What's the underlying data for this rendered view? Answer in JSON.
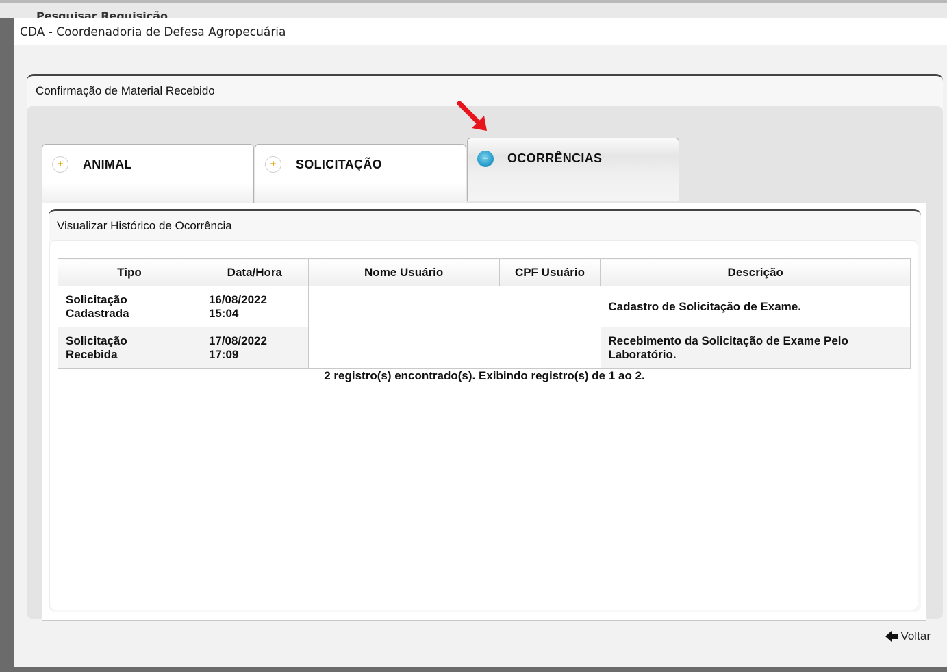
{
  "background_page": {
    "title": "Pesquisar Requisição"
  },
  "dialog": {
    "title": "CDA - Coordenadoria de Defesa Agropecuária"
  },
  "panel": {
    "title": "Confirmação de Material Recebido"
  },
  "tabs": [
    {
      "label": "ANIMAL",
      "icon": "plus-icon",
      "active": false
    },
    {
      "label": "SOLICITAÇÃO",
      "icon": "plus-icon",
      "active": false
    },
    {
      "label": "OCORRÊNCIAS",
      "icon": "minus-icon",
      "active": true
    }
  ],
  "history": {
    "title": "Visualizar Histórico de Ocorrência",
    "columns": [
      "Tipo",
      "Data/Hora",
      "Nome Usuário",
      "CPF Usuário",
      "Descrição"
    ],
    "rows": [
      {
        "tipo_l1": "Solicitação",
        "tipo_l2": "Cadastrada",
        "data": "16/08/2022",
        "hora": "15:04",
        "nome": "",
        "cpf": "",
        "descricao_l1": "Cadastro de Solicitação de Exame.",
        "descricao_l2": ""
      },
      {
        "tipo_l1": "Solicitação",
        "tipo_l2": "Recebida",
        "data": "17/08/2022",
        "hora": "17:09",
        "nome": "",
        "cpf": "",
        "descricao_l1": "Recebimento da Solicitação de Exame Pelo",
        "descricao_l2": "Laboratório."
      }
    ],
    "records_text": "2 registro(s) encontrado(s). Exibindo registro(s) de 1 ao 2."
  },
  "actions": {
    "back_label": "Voltar",
    "back_icon": "back-arrow-icon"
  },
  "colors": {
    "annotation_arrow": "#e8141b",
    "active_tab_icon": "#2ea3cf",
    "plus_icon": "#e0a300"
  }
}
